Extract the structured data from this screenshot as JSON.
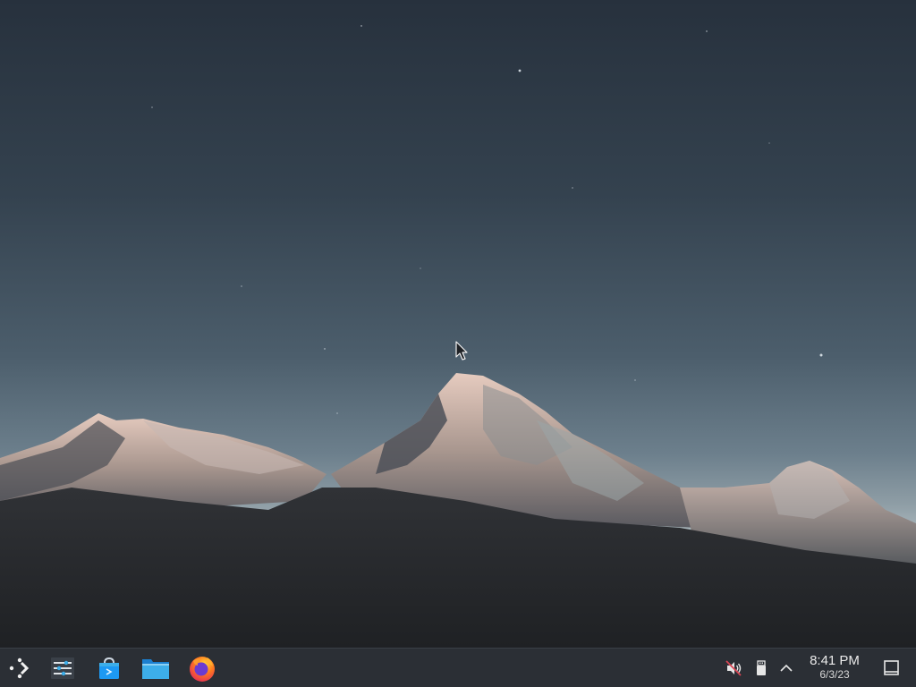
{
  "desktop": {
    "wallpaper": "mountain-dusk-wallpaper"
  },
  "taskbar": {
    "launcher_icon": "app-launcher-icon",
    "tasks": [
      {
        "name": "pager",
        "icon": "virtual-desktop-pager-icon"
      },
      {
        "name": "discover",
        "icon": "software-store-icon"
      },
      {
        "name": "dolphin",
        "icon": "folder-icon"
      },
      {
        "name": "firefox",
        "icon": "firefox-icon"
      }
    ],
    "tray": {
      "volume_icon": "volume-muted-icon",
      "device_icon": "usb-drive-icon",
      "expand_icon": "chevron-up-icon"
    },
    "clock": {
      "time": "8:41 PM",
      "date": "6/3/23"
    },
    "show_desktop_icon": "show-desktop-icon"
  },
  "colors": {
    "taskbar_bg": "#2b2f35",
    "sky_top": "#27313d",
    "sky_horizon": "#a9b6bb"
  }
}
